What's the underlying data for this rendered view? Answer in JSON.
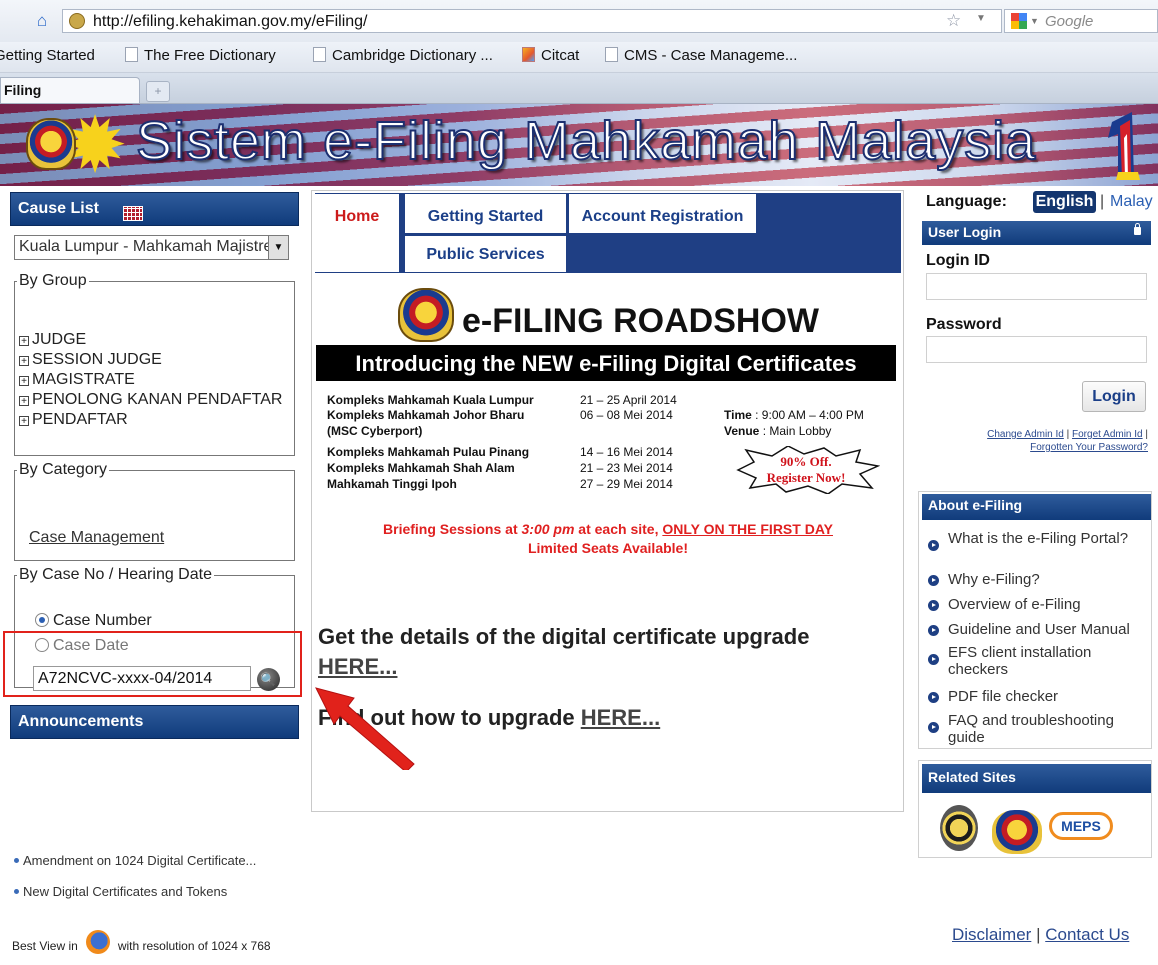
{
  "browser": {
    "url": "http://efiling.kehakiman.gov.my/eFiling/",
    "search_placeholder": "Google",
    "bookmarks": [
      {
        "label": "Getting Started",
        "icon": "page-icon"
      },
      {
        "label": "The Free Dictionary",
        "icon": "page-icon"
      },
      {
        "label": "Cambridge Dictionary ...",
        "icon": "page-icon"
      },
      {
        "label": "Citcat",
        "icon": "citcat-icon"
      },
      {
        "label": "CMS - Case Manageme...",
        "icon": "page-icon"
      }
    ],
    "tab_title": "Filing",
    "new_tab_symbol": "+"
  },
  "banner": {
    "title": "Sistem e-Filing Mahkamah Malaysia"
  },
  "left": {
    "cause_list": {
      "title": "Cause List",
      "court_selected": "Kuala Lumpur - Mahkamah Majistret"
    },
    "by_group": {
      "legend": "By Group",
      "items": [
        "JUDGE",
        "SESSION JUDGE",
        "MAGISTRATE",
        "PENOLONG KANAN PENDAFTAR",
        "PENDAFTAR"
      ]
    },
    "by_category": {
      "legend": "By Category",
      "link": "Case Management"
    },
    "by_case": {
      "legend": "By Case No / Hearing Date",
      "option_case_number": "Case Number",
      "option_case_date": "Case Date",
      "case_input_value": "A72NCVC-xxxx-04/2014"
    },
    "announcements": {
      "title": "Announcements",
      "items": [
        "Amendment on 1024 Digital Certificate...",
        "New Digital Certificates and Tokens"
      ]
    },
    "footer": {
      "prefix": "Best View in",
      "suffix": "with resolution  of 1024 x 768"
    }
  },
  "nav": {
    "home": "Home",
    "getting_started": "Getting Started",
    "account_registration": "Account Registration",
    "public_services": "Public Services"
  },
  "roadshow": {
    "title": "e-FILING ROADSHOW",
    "banner": "Introducing the NEW e-Filing Digital Certificates",
    "venues": [
      {
        "name": "Kompleks Mahkamah Kuala Lumpur",
        "date": "21 – 25 April 2014"
      },
      {
        "name": "Kompleks Mahkamah Johor Bharu",
        "date": "06 – 08 Mei 2014"
      },
      {
        "name": "(MSC Cyberport)",
        "date": ""
      },
      {
        "name": "Kompleks Mahkamah Pulau Pinang",
        "date": "14 – 16 Mei 2014"
      },
      {
        "name": "Kompleks Mahkamah Shah Alam",
        "date": "21 – 23 Mei 2014"
      },
      {
        "name": "Mahkamah Tinggi Ipoh",
        "date": "27 – 29 Mei 2014"
      }
    ],
    "time_label": "Time",
    "time_value": ": 9:00 AM – 4:00 PM",
    "venue_label": "Venue",
    "venue_value": ": Main Lobby",
    "promo_line1": "90% Off.",
    "promo_line2": "Register Now!",
    "briefing_a": "Briefing Sessions at ",
    "briefing_time": "3:00 pm",
    "briefing_b": " at each site, ",
    "briefing_first_day": "ONLY ON THE FIRST DAY",
    "briefing_seats": "Limited Seats Available!"
  },
  "content": {
    "cert_text": "Get the details of the digital certificate upgrade ",
    "cert_link": "HERE...",
    "upgrade_text": "Find out how to upgrade ",
    "upgrade_link": "HERE..."
  },
  "right": {
    "language_label": "Language:",
    "lang_english": "English",
    "lang_separator": "|",
    "lang_malay": "Malay",
    "login": {
      "title": "User Login",
      "id_label": "Login ID",
      "password_label": "Password",
      "button": "Login",
      "change_admin": "Change Admin Id",
      "forget_admin": "Forget Admin Id",
      "forgotten_password": "Forgotten Your Password?"
    },
    "about": {
      "title": "About e-Filing",
      "items": [
        "What is the e-Filing Portal?",
        "Why e-Filing?",
        "Overview of e-Filing",
        "Guideline and User Manual",
        "EFS client installation checkers",
        "PDF file checker",
        "FAQ and troubleshooting guide"
      ]
    },
    "related": {
      "title": "Related Sites",
      "meps": "MEPS"
    },
    "footer": {
      "disclaimer": "Disclaimer",
      "separator": "|",
      "contact": "Contact Us"
    }
  },
  "colors": {
    "header_blue": "#103b7b",
    "nav_blue": "#1f3f84",
    "home_red": "#cc1b1b",
    "highlight_red": "#e1221b"
  }
}
